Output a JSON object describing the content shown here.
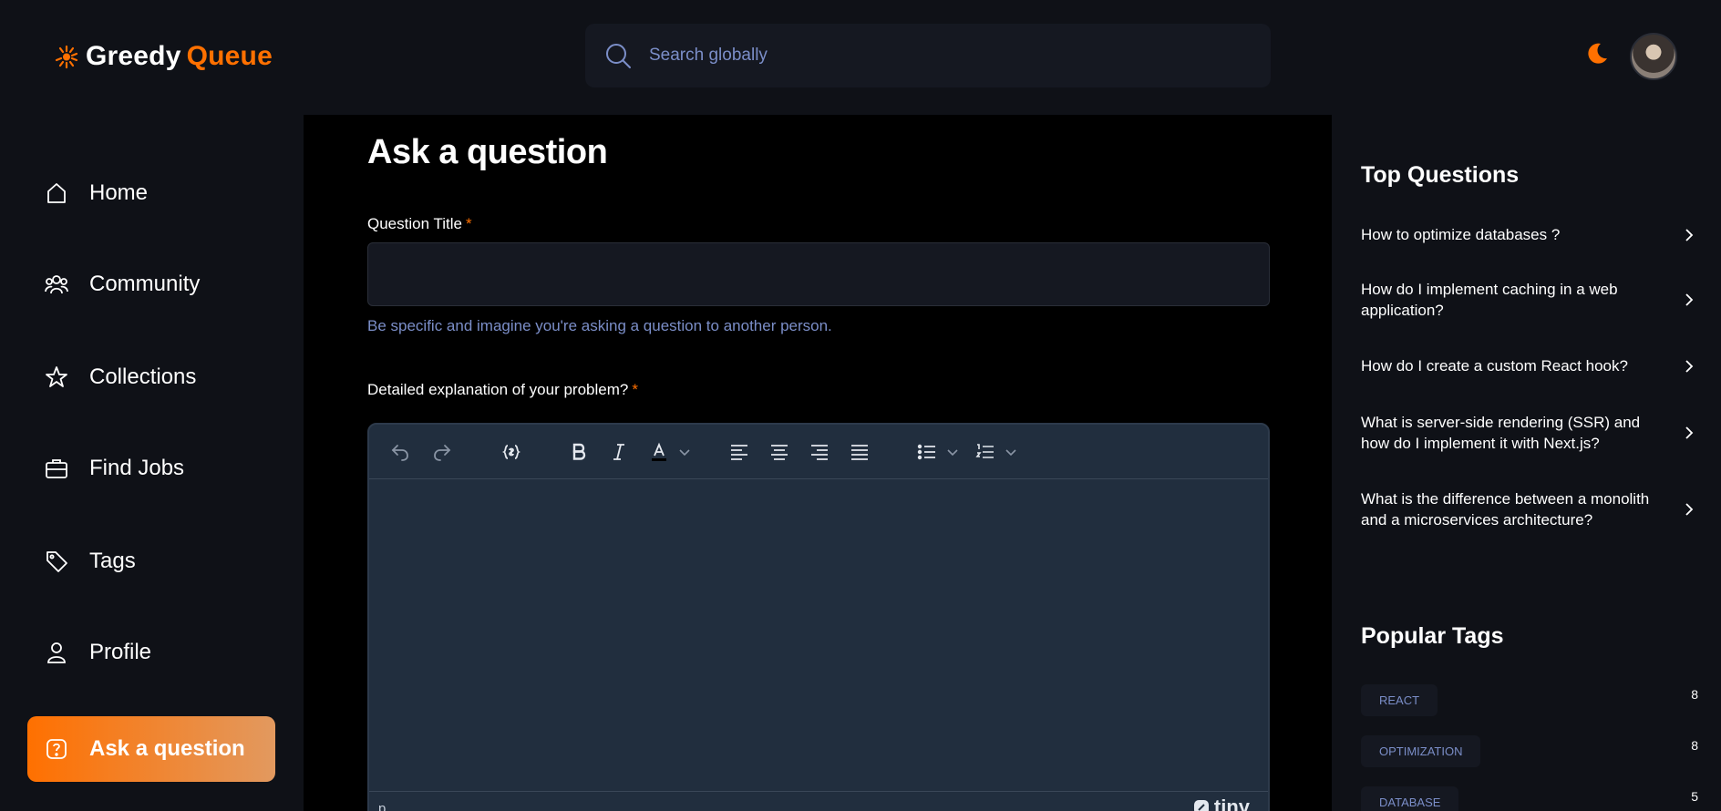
{
  "app": {
    "logo_word1": "Greedy",
    "logo_word2": "Queue",
    "accent_color": "#ff7000",
    "hint_color": "#7b8ec8"
  },
  "search": {
    "placeholder": "Search globally",
    "icon": "search-icon"
  },
  "header": {
    "theme_icon": "moon-icon",
    "avatar": "user-avatar"
  },
  "sidebar": {
    "items": [
      {
        "label": "Home",
        "icon": "home-icon"
      },
      {
        "label": "Community",
        "icon": "users-icon"
      },
      {
        "label": "Collections",
        "icon": "star-icon"
      },
      {
        "label": "Find Jobs",
        "icon": "briefcase-icon"
      },
      {
        "label": "Tags",
        "icon": "tag-icon"
      },
      {
        "label": "Profile",
        "icon": "user-icon"
      },
      {
        "label": "Ask a question",
        "icon": "question-icon",
        "active": true
      }
    ]
  },
  "main": {
    "title": "Ask a question",
    "question_title_label": "Question Title",
    "required_mark": "*",
    "question_title_value": "",
    "question_title_hint": "Be specific and imagine you're asking a question to another person.",
    "explanation_label": "Detailed explanation of your problem?",
    "editor": {
      "toolbar_icons": [
        "undo-icon",
        "redo-icon",
        "code-sample-icon",
        "bold-icon",
        "italic-icon",
        "text-color-icon",
        "chevron-down-icon",
        "align-left-icon",
        "align-center-icon",
        "align-right-icon",
        "justify-icon",
        "bullet-list-icon",
        "chevron-down-icon",
        "numbered-list-icon",
        "chevron-down-icon"
      ],
      "status_path": "p",
      "brand": "tiny"
    }
  },
  "right": {
    "top_questions_title": "Top Questions",
    "questions": [
      "How to optimize databases ?",
      "How do I implement caching in a web application?",
      "How do I create a custom React hook?",
      "What is server-side rendering (SSR) and how do I implement it with Next.js?",
      "What is the difference between a monolith and a microservices architecture?"
    ],
    "popular_tags_title": "Popular Tags",
    "tags": [
      {
        "name": "REACT",
        "count": "8"
      },
      {
        "name": "OPTIMIZATION",
        "count": "8"
      },
      {
        "name": "DATABASE",
        "count": "5"
      }
    ]
  }
}
